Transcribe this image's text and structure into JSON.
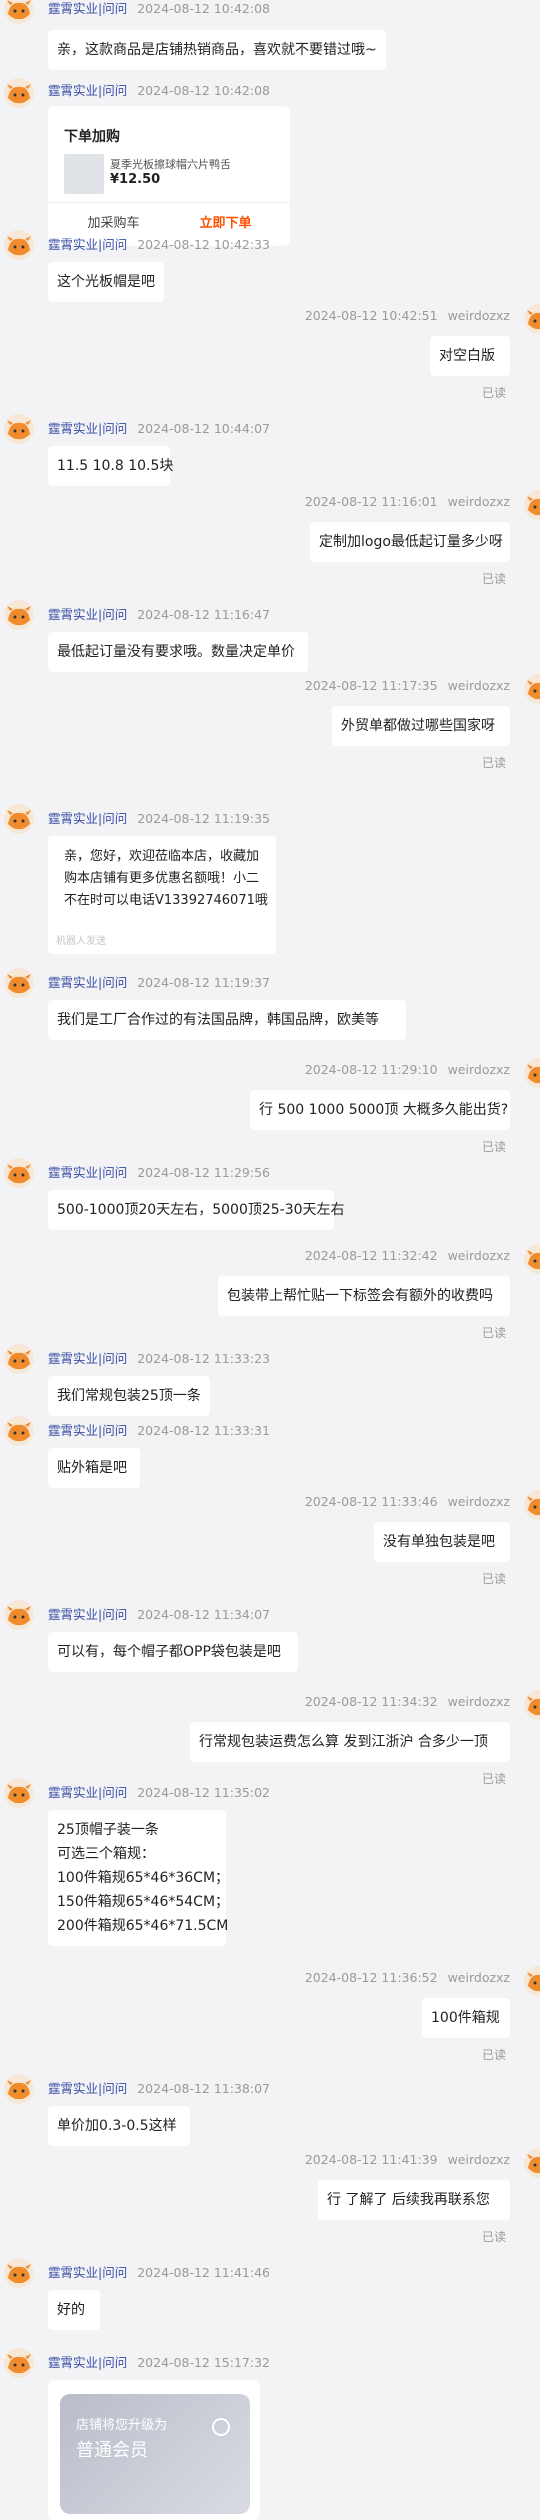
{
  "shop_name": "霆霄实业|问问",
  "me_name": "weirdozxz",
  "read_label": "已读",
  "top_message": {
    "time": "2024-08-12 10:42:08",
    "text": "亲，这款商品是店铺热销商品，喜欢就不要错过哦~"
  },
  "order_card": {
    "time": "2024-08-12 10:42:08",
    "title": "下单加购",
    "product_name": "夏季光板擦球帽六片鸭舌帽户外",
    "price": "¥12.50",
    "cart_label": "加采购车",
    "buy_label": "立即下单"
  },
  "messages": [
    {
      "side": "left",
      "time": "2024-08-12 10:42:33",
      "lines": [
        "这个光板帽是吧"
      ]
    },
    {
      "side": "right",
      "time": "2024-08-12 10:42:51",
      "lines": [
        "对空白版"
      ]
    },
    {
      "side": "left",
      "time": "2024-08-12 10:44:07",
      "lines": [
        "11.5  10.8  10.5块"
      ]
    },
    {
      "side": "right",
      "time": "2024-08-12 11:16:01",
      "lines": [
        "定制加logo最低起订量多少呀"
      ]
    },
    {
      "side": "left",
      "time": "2024-08-12 11:16:47",
      "lines": [
        "最低起订量没有要求哦。数量决定单价"
      ]
    },
    {
      "side": "right",
      "time": "2024-08-12 11:17:35",
      "lines": [
        "外贸单都做过哪些国家呀"
      ]
    },
    {
      "side": "left",
      "time": "2024-08-12 11:19:35",
      "lines": [
        "亲，您好，欢迎莅临本店，收藏加",
        "购本店铺有更多优惠名额哦！小二",
        "不在时可以电话V13392746071哦"
      ],
      "footnote": "机器人发送"
    },
    {
      "side": "left",
      "time": "2024-08-12 11:19:37",
      "lines": [
        "我们是工厂合作过的有法国品牌，韩国品牌，欧美等"
      ]
    },
    {
      "side": "right",
      "time": "2024-08-12 11:29:10",
      "lines": [
        "行 500 1000 5000顶 大概多久能出货?"
      ]
    },
    {
      "side": "left",
      "time": "2024-08-12 11:29:56",
      "lines": [
        "500-1000顶20天左右，5000顶25-30天左右"
      ]
    },
    {
      "side": "right",
      "time": "2024-08-12 11:32:42",
      "lines": [
        "包装带上帮忙贴一下标签会有额外的收费吗"
      ]
    },
    {
      "side": "left",
      "time": "2024-08-12 11:33:23",
      "lines": [
        "我们常规包装25顶一条"
      ]
    },
    {
      "side": "left",
      "time": "2024-08-12 11:33:31",
      "lines": [
        "贴外箱是吧"
      ]
    },
    {
      "side": "right",
      "time": "2024-08-12 11:33:46",
      "lines": [
        "没有单独包装是吧"
      ]
    },
    {
      "side": "left",
      "time": "2024-08-12 11:34:07",
      "lines": [
        "可以有，每个帽子都OPP袋包装是吧"
      ]
    },
    {
      "side": "right",
      "time": "2024-08-12 11:34:32",
      "lines": [
        "行常规包装运费怎么算 发到江浙沪 合多少一顶"
      ]
    },
    {
      "side": "left",
      "time": "2024-08-12 11:35:02",
      "lines": [
        "25顶帽子装一条",
        "可选三个箱规：",
        "100件箱规65*46*36CM；",
        "150件箱规65*46*54CM；",
        "200件箱规65*46*71.5CM"
      ]
    },
    {
      "side": "right",
      "time": "2024-08-12 11:36:52",
      "lines": [
        "100件箱规"
      ]
    },
    {
      "side": "left",
      "time": "2024-08-12 11:38:07",
      "lines": [
        "单价加0.3-0.5这样"
      ]
    },
    {
      "side": "right",
      "time": "2024-08-12 11:41:39",
      "lines": [
        "行 了解了 后续我再联系您"
      ]
    },
    {
      "side": "left",
      "time": "2024-08-12 11:41:46",
      "lines": [
        "好的"
      ]
    }
  ],
  "vip_card": {
    "time": "2024-08-12 15:17:32",
    "line1": "店铺将您升级为",
    "line2": "普通会员"
  },
  "colors": {
    "background": "#f3f3f5",
    "shop_name": "#3b4fa8",
    "buy_button": "#ff5000",
    "bubble": "#ffffff"
  }
}
